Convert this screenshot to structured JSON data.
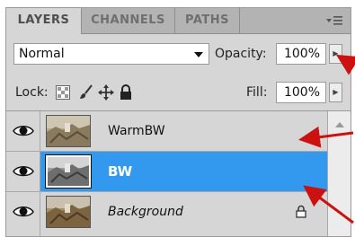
{
  "tabs": [
    {
      "label": "LAYERS"
    },
    {
      "label": "CHANNELS"
    },
    {
      "label": "PATHS"
    }
  ],
  "panel_menu_icon": "panel-menu-icon",
  "blend": {
    "value": "Normal"
  },
  "opacity": {
    "label": "Opacity:",
    "value": "100%"
  },
  "lock": {
    "label": "Lock:"
  },
  "fill": {
    "label": "Fill:",
    "value": "100%"
  },
  "layers": [
    {
      "name": "WarmBW",
      "selected": false,
      "visible": true
    },
    {
      "name": "BW",
      "selected": true,
      "visible": true
    },
    {
      "name": "Background",
      "selected": false,
      "visible": true,
      "locked": true
    }
  ],
  "colors": {
    "selection": "#3399ee",
    "arrow": "#cc1111",
    "panel": "#d6d6d6"
  }
}
